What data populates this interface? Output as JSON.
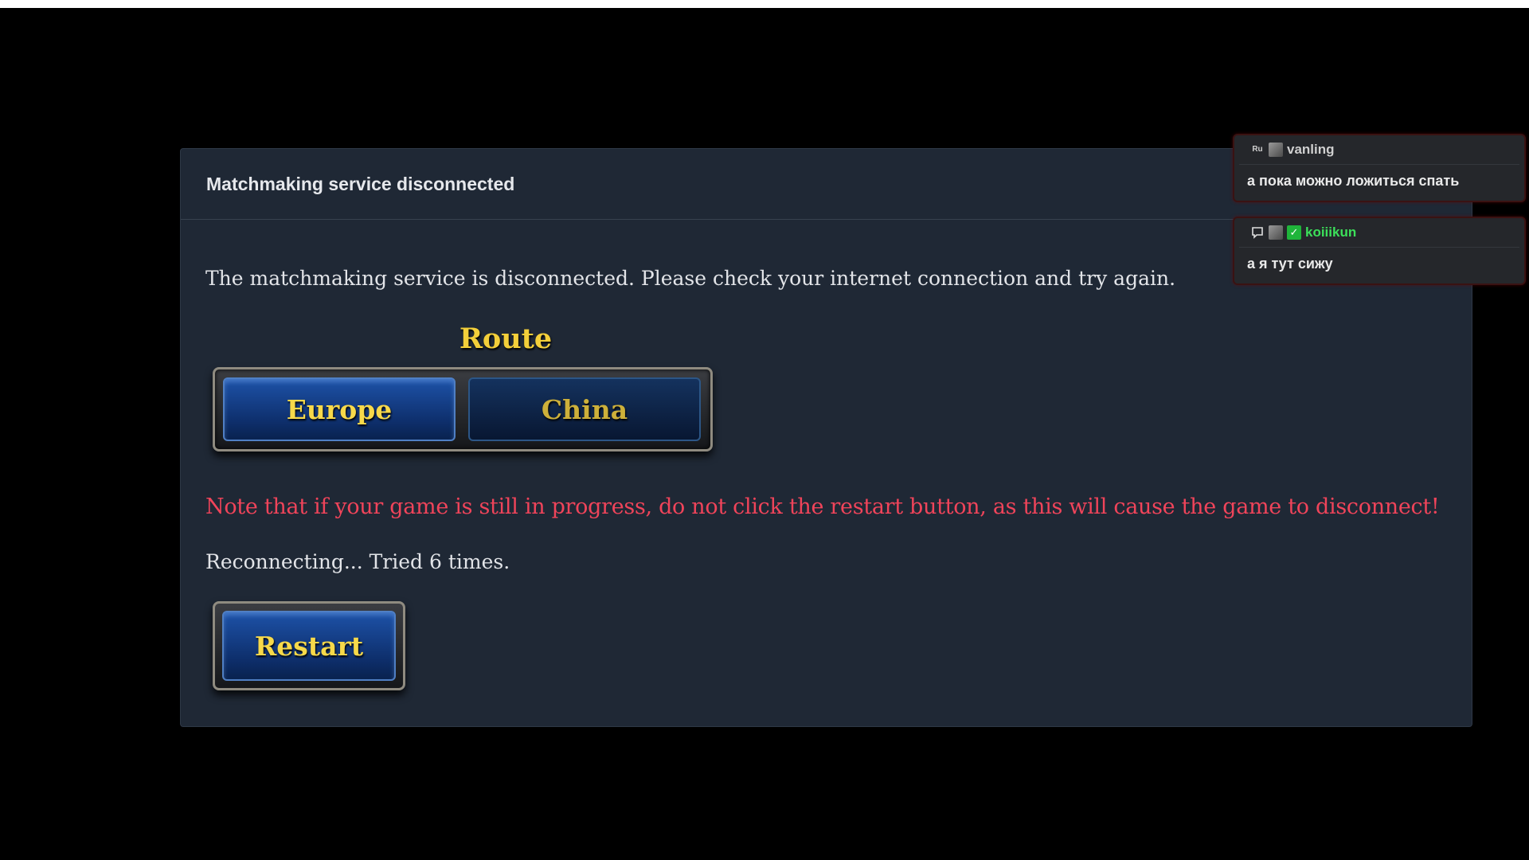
{
  "dialog": {
    "title": "Matchmaking service disconnected",
    "message": "The matchmaking service is disconnected. Please check your internet connection and try again.",
    "route": {
      "title": "Route",
      "options": [
        "Europe",
        "China"
      ],
      "selected": "Europe"
    },
    "warning": "Note that if your game is still in progress, do not click the restart button, as this will cause the game to disconnect!",
    "status": "Reconnecting... Tried 6 times.",
    "restart_label": "Restart",
    "colors": {
      "background": "#1f2835",
      "warning": "#f0445a",
      "route_title": "#f3cf3a",
      "button_text": "#f7d94a",
      "button_fill": "#0e2f6c"
    }
  },
  "chat": {
    "messages": [
      {
        "badge": "Ru",
        "username": "vanling",
        "username_color": "#cfcfcf",
        "text": "а пока можно ложиться спать"
      },
      {
        "badge_icon": "chat-bubble-icon",
        "username": "koiiikun",
        "username_color": "#3ce05a",
        "text": "а я тут сижу"
      }
    ]
  }
}
